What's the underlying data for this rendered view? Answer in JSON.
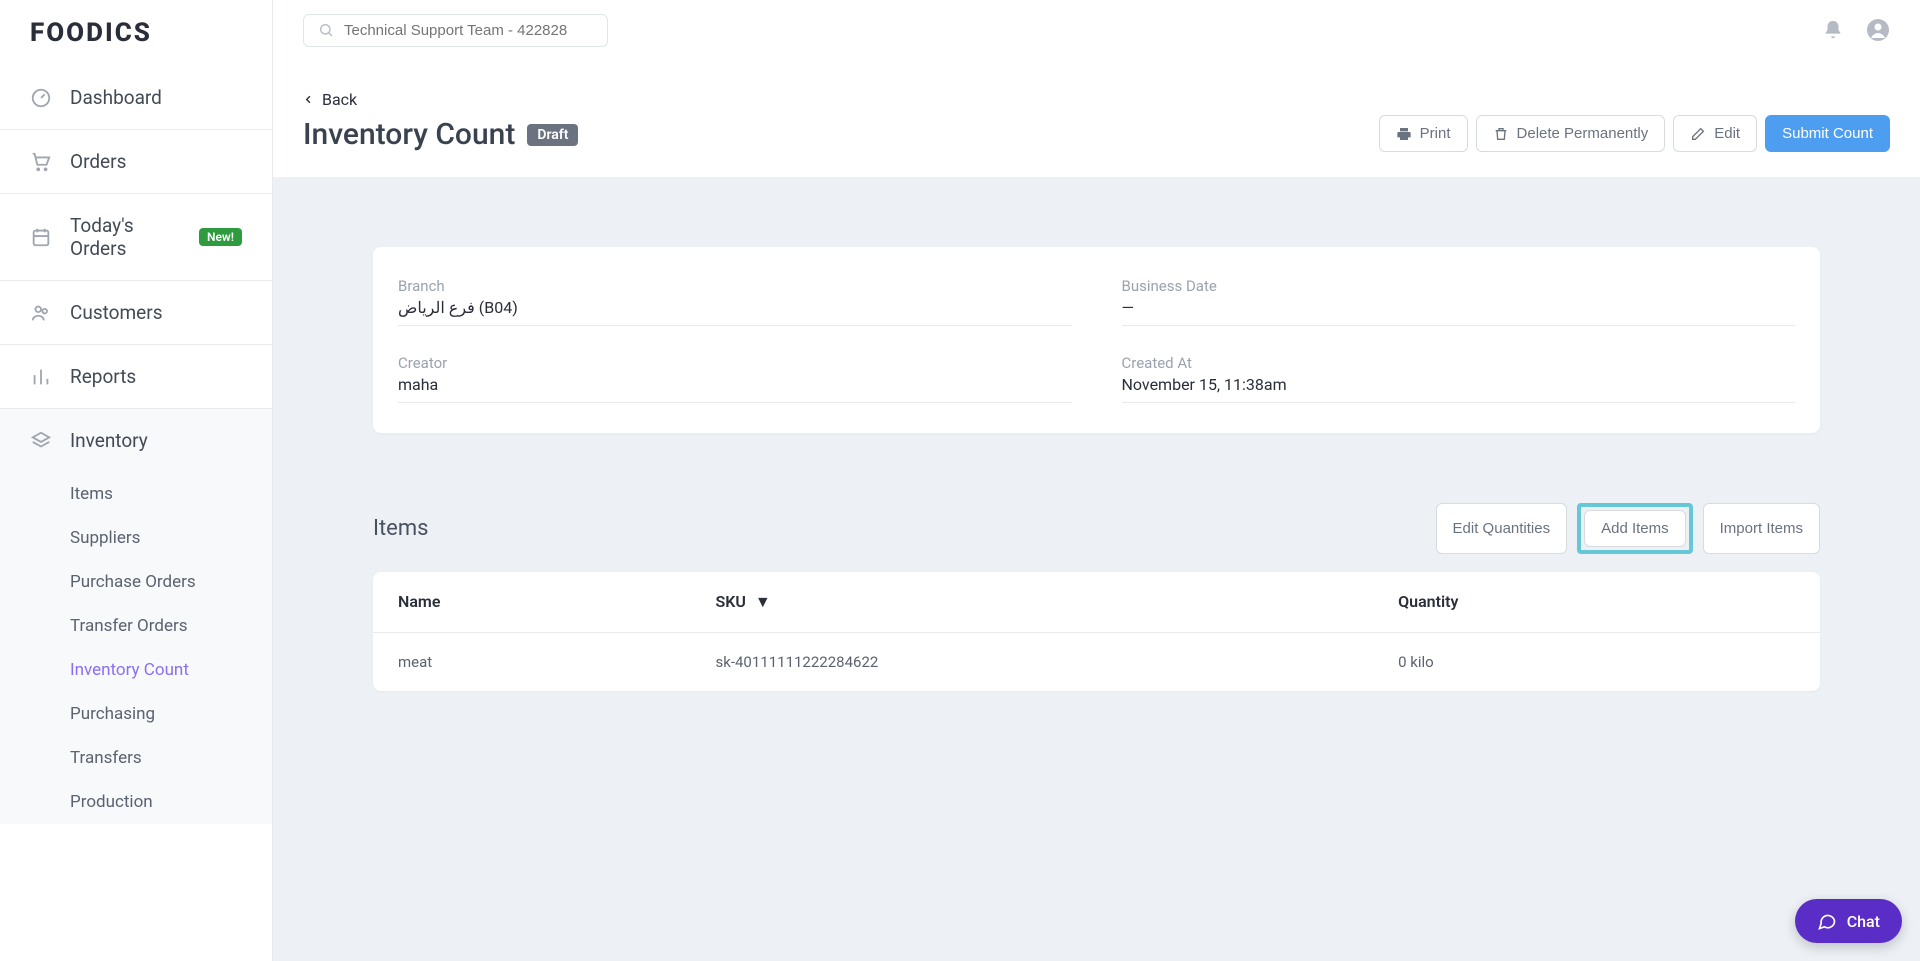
{
  "logo": "FOODICS",
  "search": {
    "placeholder": "Technical Support Team - 422828"
  },
  "sidebar": {
    "items": [
      {
        "label": "Dashboard"
      },
      {
        "label": "Orders"
      },
      {
        "label": "Today's Orders",
        "badge": "New!"
      },
      {
        "label": "Customers"
      },
      {
        "label": "Reports"
      },
      {
        "label": "Inventory"
      }
    ],
    "sub_items": [
      {
        "label": "Items"
      },
      {
        "label": "Suppliers"
      },
      {
        "label": "Purchase Orders"
      },
      {
        "label": "Transfer Orders"
      },
      {
        "label": "Inventory Count"
      },
      {
        "label": "Purchasing"
      },
      {
        "label": "Transfers"
      },
      {
        "label": "Production"
      }
    ]
  },
  "header": {
    "back": "Back",
    "title": "Inventory Count",
    "status": "Draft",
    "actions": {
      "print": "Print",
      "delete": "Delete Permanently",
      "edit": "Edit",
      "submit": "Submit Count"
    }
  },
  "info": {
    "branch_label": "Branch",
    "branch_value": "فرع الرياض (B04)",
    "business_date_label": "Business Date",
    "business_date_value": "—",
    "creator_label": "Creator",
    "creator_value": "maha",
    "created_at_label": "Created At",
    "created_at_value": "November 15, 11:38am"
  },
  "items_section": {
    "title": "Items",
    "actions": {
      "edit_qty": "Edit Quantities",
      "add_items": "Add Items",
      "import_items": "Import Items"
    },
    "columns": {
      "name": "Name",
      "sku": "SKU",
      "quantity": "Quantity"
    },
    "rows": [
      {
        "name": "meat",
        "sku": "sk-40111111222284622",
        "quantity": "0 kilo"
      }
    ]
  },
  "chat": {
    "label": "Chat"
  }
}
